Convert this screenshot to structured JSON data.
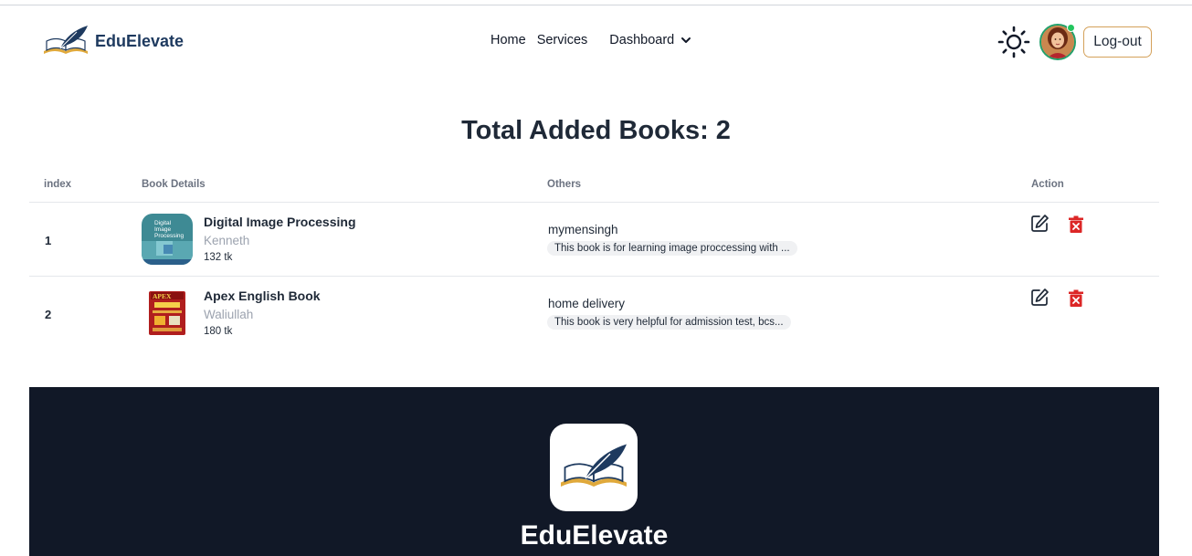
{
  "brand": {
    "name": "EduElevate"
  },
  "nav": {
    "home": "Home",
    "services": "Services",
    "dashboard": "Dashboard"
  },
  "header": {
    "logout": "Log-out"
  },
  "page": {
    "title": "Total Added Books: 2"
  },
  "table": {
    "headers": {
      "index": "index",
      "details": "Book Details",
      "others": "Others",
      "action": "Action"
    },
    "rows": [
      {
        "index": "1",
        "title": "Digital Image Processing",
        "author": "Kenneth",
        "price": "132 tk",
        "location": "mymensingh",
        "description": "This book is for learning image proccessing with ..."
      },
      {
        "index": "2",
        "title": "Apex English Book",
        "author": "Waliullah",
        "price": "180 tk",
        "location": "home delivery",
        "description": "This book is very helpful for admission test, bcs..."
      }
    ]
  },
  "footer": {
    "name": "EduElevate"
  },
  "icons": {
    "brand_logo": "book-quill-icon",
    "dashboard_chevron": "chevron-down-icon",
    "theme": "sun-icon",
    "edit": "edit-icon",
    "delete": "trash-icon"
  },
  "colors": {
    "brand": "#1e3a5f",
    "logout_border": "#d4a15a",
    "delete": "#dc2626",
    "footer_bg": "#111827",
    "online": "#22c55e"
  }
}
